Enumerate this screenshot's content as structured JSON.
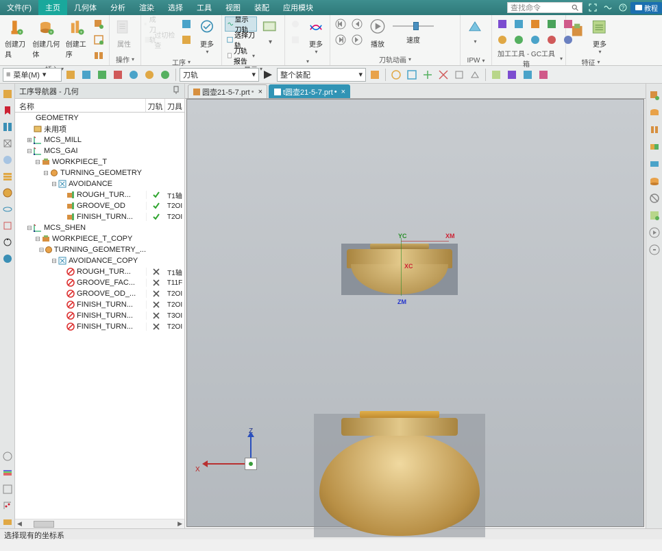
{
  "menubar": {
    "items": [
      "文件(F)",
      "主页",
      "几何体",
      "分析",
      "渲染",
      "选择",
      "工具",
      "视图",
      "装配",
      "应用模块"
    ],
    "active_index": 1,
    "search_placeholder": "查找命令",
    "tutorial_label": "教程"
  },
  "ribbon": {
    "groups": [
      {
        "label": "插入",
        "items": [
          "创建刀具",
          "创建几何体",
          "创建工序"
        ]
      },
      {
        "label": "操作",
        "items": [
          "属性"
        ]
      },
      {
        "label": "工序",
        "items_small": [
          "生成刀轨",
          "过切检查"
        ],
        "more": "更多"
      },
      {
        "label": "显示",
        "items_small": [
          "显示刀轨",
          "选择刀轨",
          "刀轨报告"
        ]
      },
      {
        "label": "——",
        "more": "更多"
      },
      {
        "label": "刀轨动画",
        "play": "播放",
        "speed": "速度"
      },
      {
        "label": "IPW"
      },
      {
        "label": "加工工具 - GC工具箱"
      },
      {
        "label": "特征",
        "more": "更多"
      }
    ]
  },
  "toolbar": {
    "menu_label": "菜单(M)",
    "combo1": "刀轨",
    "combo2": "整个装配"
  },
  "nav": {
    "title": "工序导航器 - 几何",
    "columns": [
      "名称",
      "刀轨",
      "刀具"
    ],
    "tree": [
      {
        "d": 0,
        "tw": "",
        "icon": "root",
        "label": "GEOMETRY"
      },
      {
        "d": 1,
        "tw": "",
        "icon": "unused",
        "label": "未用项"
      },
      {
        "d": 1,
        "tw": "+",
        "icon": "mcs",
        "label": "MCS_MILL"
      },
      {
        "d": 1,
        "tw": "-",
        "icon": "mcs",
        "label": "MCS_GAI"
      },
      {
        "d": 2,
        "tw": "-",
        "icon": "wp",
        "label": "WORKPIECE_T"
      },
      {
        "d": 3,
        "tw": "-",
        "icon": "tg",
        "label": "TURNING_GEOMETRY"
      },
      {
        "d": 4,
        "tw": "-",
        "icon": "av",
        "label": "AVOIDANCE"
      },
      {
        "d": 5,
        "tw": "",
        "icon": "op",
        "label": "ROUGH_TUR...",
        "c1": "check",
        "c2": "T1轴"
      },
      {
        "d": 5,
        "tw": "",
        "icon": "op",
        "label": "GROOVE_OD",
        "c1": "check",
        "c2": "T2OI"
      },
      {
        "d": 5,
        "tw": "",
        "icon": "op",
        "label": "FINISH_TURN...",
        "c1": "check",
        "c2": "T2OI"
      },
      {
        "d": 1,
        "tw": "-",
        "icon": "mcs",
        "label": "MCS_SHEN"
      },
      {
        "d": 2,
        "tw": "-",
        "icon": "wp",
        "label": "WORKPIECE_T_COPY"
      },
      {
        "d": 3,
        "tw": "-",
        "icon": "tg",
        "label": "TURNING_GEOMETRY_..."
      },
      {
        "d": 4,
        "tw": "-",
        "icon": "av",
        "label": "AVOIDANCE_COPY"
      },
      {
        "d": 5,
        "tw": "",
        "icon": "no",
        "label": "ROUGH_TUR...",
        "c1": "x",
        "c2": "T1轴"
      },
      {
        "d": 5,
        "tw": "",
        "icon": "no",
        "label": "GROOVE_FAC...",
        "c1": "x",
        "c2": "T11F"
      },
      {
        "d": 5,
        "tw": "",
        "icon": "no",
        "label": "GROOVE_OD_...",
        "c1": "x",
        "c2": "T2OI"
      },
      {
        "d": 5,
        "tw": "",
        "icon": "no",
        "label": "FINISH_TURN...",
        "c1": "x",
        "c2": "T2OI"
      },
      {
        "d": 5,
        "tw": "",
        "icon": "no",
        "label": "FINISH_TURN...",
        "c1": "x",
        "c2": "T3OI"
      },
      {
        "d": 5,
        "tw": "",
        "icon": "no",
        "label": "FINISH_TURN...",
        "c1": "x",
        "c2": "T2OI"
      }
    ]
  },
  "tabs": {
    "items": [
      {
        "label": "圆壶21-5-7.prt",
        "active": false,
        "dirty": true
      },
      {
        "label": "t圆壶21-5-7.prt",
        "active": true,
        "dirty": true
      }
    ]
  },
  "canvas": {
    "axis": {
      "yc": "YC",
      "xm": "XM",
      "xc": "XC",
      "zm": "ZM",
      "z": "Z",
      "x": "X"
    }
  },
  "status": {
    "text": "选择现有的坐标系"
  }
}
